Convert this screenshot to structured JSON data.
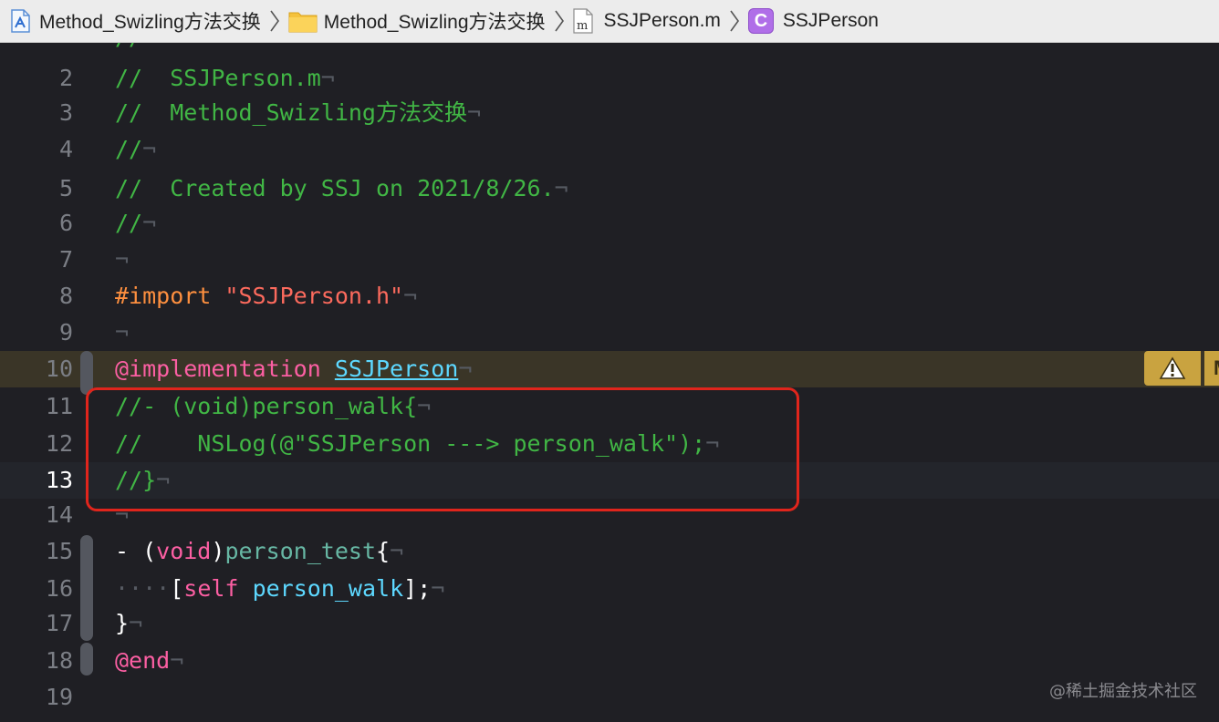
{
  "breadcrumb": {
    "project": "Method_Swizling方法交换",
    "folder": "Method_Swizling方法交换",
    "file": "SSJPerson.m",
    "symbol": "SSJPerson",
    "file_icon_letter": "m",
    "symbol_icon_letter": "C"
  },
  "editor": {
    "current_line": 13,
    "warning_line": 10,
    "warning_tail": "M",
    "lines": [
      {
        "n": "2"
      },
      {
        "n": "3"
      },
      {
        "n": "4"
      },
      {
        "n": "5"
      },
      {
        "n": "6"
      },
      {
        "n": "7"
      },
      {
        "n": "8"
      },
      {
        "n": "9"
      },
      {
        "n": "10"
      },
      {
        "n": "11"
      },
      {
        "n": "12"
      },
      {
        "n": "13"
      },
      {
        "n": "14"
      },
      {
        "n": "15"
      },
      {
        "n": "16"
      },
      {
        "n": "17"
      },
      {
        "n": "18"
      },
      {
        "n": "19"
      }
    ],
    "code": {
      "l2": "//  SSJPerson.m",
      "l3": "//  Method_Swizling方法交换",
      "l4": "//",
      "l5": "//  Created by SSJ on 2021/8/26.",
      "l6": "//",
      "l8_directive": "#import",
      "l8_string": "\"SSJPerson.h\"",
      "l10_kw": "@implementation",
      "l10_class": "SSJPerson",
      "l11": "//- (void)person_walk{",
      "l12": "//    NSLog(@\"SSJPerson ---> person_walk\");",
      "l13": "//}",
      "l15_dash": "- (",
      "l15_type": "void",
      "l15_paren": ")",
      "l15_name": "person_test",
      "l15_brace": "{",
      "l16_open": "[",
      "l16_self": "self",
      "l16_msg": "person_walk",
      "l16_close": "];",
      "l17": "}",
      "l18": "@end"
    },
    "invisible_marker": "¬"
  },
  "watermark": "@稀土掘金技术社区",
  "colors": {
    "background": "#1f1f24",
    "comment": "#41b645",
    "preprocessor": "#fd8f3f",
    "string": "#fc6a5d",
    "keyword": "#fc5fa3",
    "type": "#5dd8ff",
    "method": "#67b7a4",
    "highlight_box": "#e0251c",
    "warning": "#c9a340"
  }
}
